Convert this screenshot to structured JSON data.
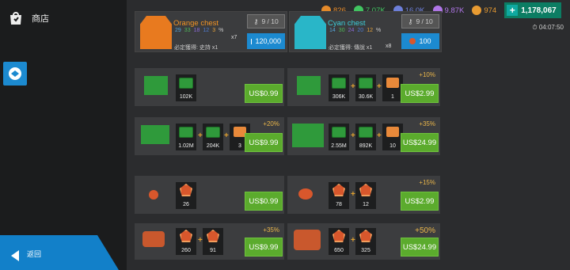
{
  "sidebar": {
    "shop_label": "商店",
    "back_label": "返回"
  },
  "topbar": {
    "resources": [
      {
        "value": "826",
        "color": "#e58a2a",
        "icon": "gold-coin-icon"
      },
      {
        "value": "7.07K",
        "color": "#41c461",
        "icon": "green-token-icon"
      },
      {
        "value": "16.0K",
        "color": "#6d7fd9",
        "icon": "blue-token-icon"
      },
      {
        "value": "9.87K",
        "color": "#b076e8",
        "icon": "purple-token-icon"
      },
      {
        "value": "974",
        "color": "#e89b32",
        "icon": "orange-token-icon"
      }
    ],
    "cash": "1,178,067",
    "timer": "04:07:50"
  },
  "chests": [
    {
      "name": "Orange chest",
      "name_color": "#f39423",
      "nums": [
        "29",
        "33",
        "18",
        "12",
        "3",
        "%"
      ],
      "num_colors": [
        "#53a3d8",
        "#4fb859",
        "#8a6ad7",
        "#4f7bd0",
        "#e8a33a",
        "#ccc"
      ],
      "sub": "必定獲得: 史詩 x1",
      "multiplier": "x7",
      "counter": "9 / 10",
      "price": "120,000"
    },
    {
      "name": "Cyan chest",
      "name_color": "#3ccdd8",
      "nums": [
        "14",
        "30",
        "24",
        "20",
        "12",
        "%"
      ],
      "num_colors": [
        "#53a3d8",
        "#4fb859",
        "#8a6ad7",
        "#4f7bd0",
        "#e8a33a",
        "#ccc"
      ],
      "sub": "必定獲得: 傳說 x1",
      "multiplier": "x8",
      "counter": "9 / 10",
      "price": "100"
    }
  ],
  "packs": [
    {
      "bonus": "",
      "items": [
        {
          "type": "cash",
          "label": "102K"
        }
      ],
      "price": "US$0.99"
    },
    {
      "bonus": "+10%",
      "items": [
        {
          "type": "cash",
          "label": "306K"
        },
        {
          "type": "cash",
          "label": "30.6K"
        },
        {
          "type": "ticket",
          "label": "1"
        }
      ],
      "price": "US$2.99"
    },
    {
      "bonus": "+20%",
      "items": [
        {
          "type": "cash",
          "label": "1.02M"
        },
        {
          "type": "cash",
          "label": "204K"
        },
        {
          "type": "ticket",
          "label": "3"
        }
      ],
      "price": "US$9.99"
    },
    {
      "bonus": "+35%",
      "items": [
        {
          "type": "cash",
          "label": "2.55M"
        },
        {
          "type": "cash",
          "label": "892K"
        },
        {
          "type": "ticket",
          "label": "10"
        }
      ],
      "price": "US$24.99"
    },
    {
      "bonus": "",
      "items": [
        {
          "type": "gold",
          "label": "26"
        }
      ],
      "price": "US$0.99"
    },
    {
      "bonus": "+15%",
      "items": [
        {
          "type": "gold",
          "label": "78"
        },
        {
          "type": "gold",
          "label": "12"
        }
      ],
      "price": "US$2.99"
    },
    {
      "bonus": "+35%",
      "items": [
        {
          "type": "gold",
          "label": "260"
        },
        {
          "type": "gold",
          "label": "91"
        }
      ],
      "price": "US$9.99"
    },
    {
      "bonus": "+50%",
      "items": [
        {
          "type": "gold",
          "label": "650"
        },
        {
          "type": "gold",
          "label": "325"
        }
      ],
      "price": "US$24.99"
    }
  ]
}
